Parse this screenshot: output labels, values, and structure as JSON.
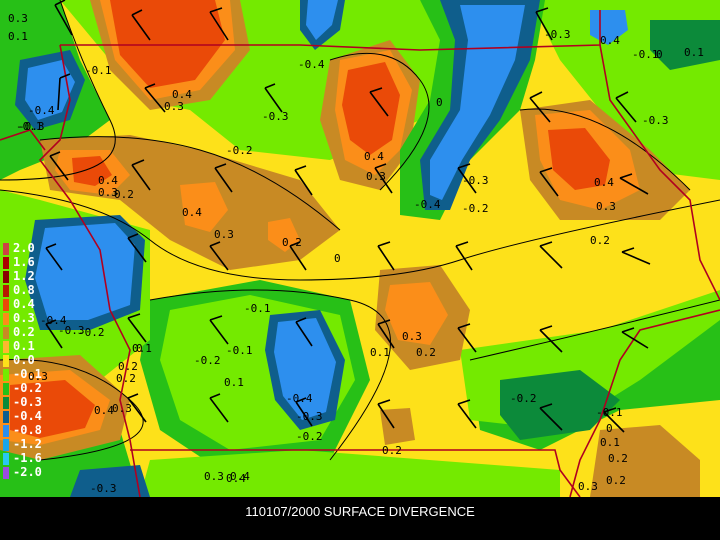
{
  "title": "110107/2000 SURFACE DIVERGENCE",
  "legend": {
    "items": [
      {
        "label": "2.0",
        "color": "#cc4444"
      },
      {
        "label": "1.6",
        "color": "#aa0000"
      },
      {
        "label": "1.2",
        "color": "#880000"
      },
      {
        "label": "0.8",
        "color": "#b51a00"
      },
      {
        "label": "0.4",
        "color": "#ea4a08"
      },
      {
        "label": "0.3",
        "color": "#fb8e19"
      },
      {
        "label": "0.2",
        "color": "#c88a24"
      },
      {
        "label": "0.1",
        "color": "#ffb82e"
      },
      {
        "label": "0.0",
        "color": "#fde11a"
      },
      {
        "label": "-0.1",
        "color": "#74ea00"
      },
      {
        "label": "-0.2",
        "color": "#27c017"
      },
      {
        "label": "-0.3",
        "color": "#0c8a3a"
      },
      {
        "label": "-0.4",
        "color": "#0f5e8c"
      },
      {
        "label": "-0.8",
        "color": "#2d8fee"
      },
      {
        "label": "-1.2",
        "color": "#1aa5e8"
      },
      {
        "label": "-1.6",
        "color": "#28c8f0"
      },
      {
        "label": "-2.0",
        "color": "#9a4ce0"
      }
    ]
  },
  "contour_labels": [
    {
      "text": "0.3"
    },
    {
      "text": "0.1"
    },
    {
      "text": "0.4"
    },
    {
      "text": "0.3"
    },
    {
      "text": "-0.1"
    },
    {
      "text": "-0.3"
    },
    {
      "text": "-0.4"
    },
    {
      "text": "-0.2"
    },
    {
      "text": "0.4"
    },
    {
      "text": "0.3"
    },
    {
      "text": "0.2"
    },
    {
      "text": "0.4"
    },
    {
      "text": "0.3"
    },
    {
      "text": "0.4"
    },
    {
      "text": "0.3"
    },
    {
      "text": "0.2"
    },
    {
      "text": "0"
    },
    {
      "text": "-0.1"
    },
    {
      "text": "-0.4"
    },
    {
      "text": "-0.3"
    },
    {
      "text": "-0.2"
    },
    {
      "text": "0.1"
    },
    {
      "text": "0.2"
    },
    {
      "text": "0.3"
    },
    {
      "text": "0.2"
    },
    {
      "text": "-0.4"
    },
    {
      "text": "-0.3"
    },
    {
      "text": "-0.2"
    },
    {
      "text": "0.4"
    },
    {
      "text": "0.3"
    },
    {
      "text": "0.1"
    },
    {
      "text": "0.2"
    },
    {
      "text": "-0.1"
    },
    {
      "text": "0"
    },
    {
      "text": "-0.2"
    },
    {
      "text": "0.4"
    },
    {
      "text": "-0.3"
    },
    {
      "text": "0.1"
    },
    {
      "text": "0.3"
    },
    {
      "text": "0.2"
    },
    {
      "text": "0.4"
    },
    {
      "text": "0.3"
    },
    {
      "text": "-0.2"
    },
    {
      "text": "0"
    },
    {
      "text": "0.2"
    },
    {
      "text": "-0.4"
    },
    {
      "text": "-0.3"
    },
    {
      "text": "0.3"
    },
    {
      "text": "0.4"
    },
    {
      "text": "-0.3"
    },
    {
      "text": "0.2"
    },
    {
      "text": "-0.2"
    },
    {
      "text": "-0.1"
    },
    {
      "text": "0"
    },
    {
      "text": "0.1"
    },
    {
      "text": "0.2"
    },
    {
      "text": "0.3"
    },
    {
      "text": "-0.1"
    },
    {
      "text": "0"
    },
    {
      "text": "0.1"
    },
    {
      "text": "-0.3"
    },
    {
      "text": "0.4"
    },
    {
      "text": "-0.1"
    },
    {
      "text": "-0.4"
    },
    {
      "text": "-0.3"
    }
  ]
}
